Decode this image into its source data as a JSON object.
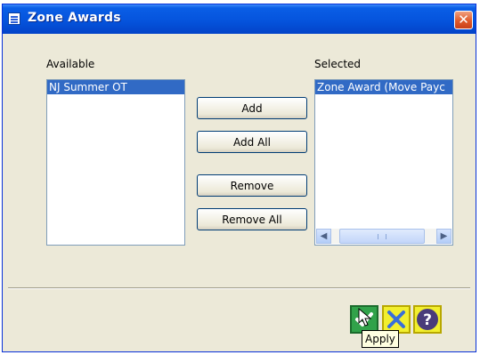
{
  "window": {
    "title": "Zone Awards",
    "close_symbol": "✕"
  },
  "available": {
    "label": "Available",
    "items": [
      "NJ Summer OT"
    ]
  },
  "selected": {
    "label": "Selected",
    "items": [
      "Zone Award (Move Payc"
    ]
  },
  "buttons": {
    "add": "Add",
    "add_all": "Add All",
    "remove": "Remove",
    "remove_all": "Remove All"
  },
  "footer": {
    "apply_tooltip": "Apply",
    "apply_icon": "check-icon",
    "cancel_icon": "x-icon",
    "help_icon": "question-icon"
  },
  "colors": {
    "title_bar": "#0554dd",
    "selection": "#316ac5",
    "apply": "#31a24a",
    "cancel": "#f2ef2e",
    "help": "#f2ef2e"
  }
}
